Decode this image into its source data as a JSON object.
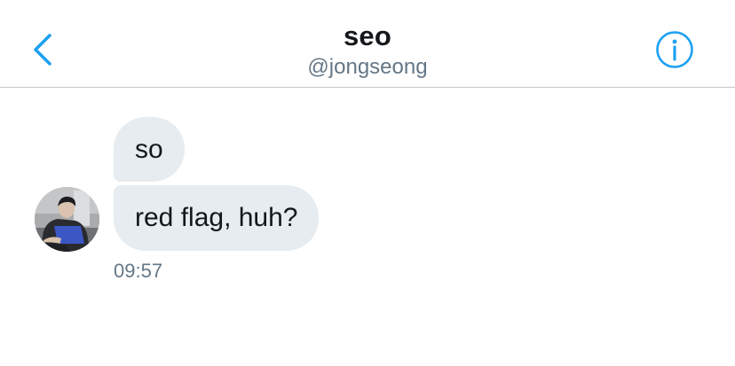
{
  "header": {
    "title": "seo",
    "handle": "@jongseong",
    "back_icon": "chevron-left-icon",
    "info_icon": "info-circle-icon"
  },
  "conversation": {
    "messages": [
      {
        "text": "so"
      },
      {
        "text": "red flag, huh?"
      }
    ],
    "timestamp": "09:57"
  },
  "colors": {
    "accent": "#1da1f2",
    "bubble_background": "#e6ecf0",
    "primary_text": "#14171a",
    "secondary_text": "#657786",
    "divider": "#c7c7cc"
  }
}
